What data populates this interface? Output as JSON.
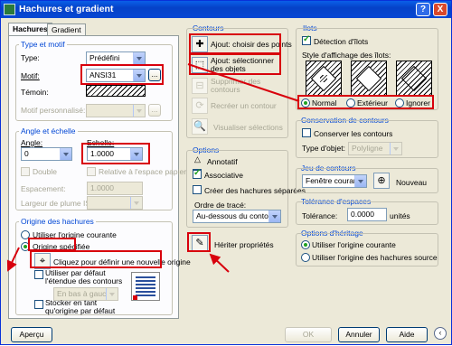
{
  "window": {
    "title": "Hachures et gradient",
    "help": "?",
    "close": "X"
  },
  "tabs": [
    "Hachures",
    "Gradient"
  ],
  "type_motif": {
    "title": "Type et motif",
    "type_label": "Type:",
    "type_value": "Prédéfini",
    "motif_label": "Motif:",
    "motif_value": "ANSI31",
    "more_btn": "...",
    "temoin_label": "Témoin:",
    "motif_perso_label": "Motif personnalisé:"
  },
  "angle_echelle": {
    "title": "Angle et échelle",
    "angle_label": "Angle:",
    "angle_value": "0",
    "echelle_label": "Echelle:",
    "echelle_value": "1.0000",
    "double_label": "Double",
    "relative_label": "Relative à l'espace papier",
    "espacement_label": "Espacement:",
    "espacement_value": "1.0000",
    "largeur_label": "Largeur de plume ISO:"
  },
  "origine": {
    "title": "Origine des hachures",
    "courante_label": "Utiliser l'origine courante",
    "specifiee_label": "Origine spécifiée",
    "click_label": "Cliquez pour définir une nouvelle origine",
    "defaut_label": "Utiliser par défaut l'étendue des contours",
    "position_value": "En bas à gauche",
    "stocker_label": "Stocker en tant qu'origine par défaut"
  },
  "contours": {
    "title": "Contours",
    "points_label": "Ajout: choisir des points",
    "objets_label": "Ajout: sélectionner des objets",
    "supprimer_label": "Supprimer des contours",
    "recreer_label": "Recréer un contour",
    "visualiser_label": "Visualiser sélections"
  },
  "options": {
    "title": "Options",
    "annotatif_label": "Annotatif",
    "associative_label": "Associative",
    "creer_label": "Créer des hachures séparées",
    "ordre_label": "Ordre de tracé:",
    "ordre_value": "Au-dessous du contour"
  },
  "heriter_label": "Hériter propriétés",
  "ilots": {
    "title": "Ilots",
    "detection_label": "Détection d'îlots",
    "style_label": "Style d'affichage des îlots:",
    "normal_label": "Normal",
    "exterieur_label": "Extérieur",
    "ignorer_label": "Ignorer"
  },
  "conservation": {
    "title": "Conservation de contours",
    "conserver_label": "Conserver les contours",
    "type_objet_label": "Type d'objet:",
    "type_objet_value": "Polyligne"
  },
  "jeu": {
    "title": "Jeu de contours",
    "value": "Fenêtre courante",
    "nouveau_label": "Nouveau"
  },
  "tolerance": {
    "title": "Tolérance d'espaces",
    "label": "Tolérance:",
    "value": "0.0000",
    "unit": "unités"
  },
  "heritage": {
    "title": "Options d'héritage",
    "courante_label": "Utiliser l'origine courante",
    "source_label": "Utiliser l'origine des hachures source"
  },
  "footer": {
    "apercu": "Aperçu",
    "ok": "OK",
    "annuler": "Annuler",
    "aide": "Aide"
  },
  "colors": {
    "accent": "#0046d5",
    "highlight": "#d8000c",
    "title_bar": "#0542c8"
  }
}
